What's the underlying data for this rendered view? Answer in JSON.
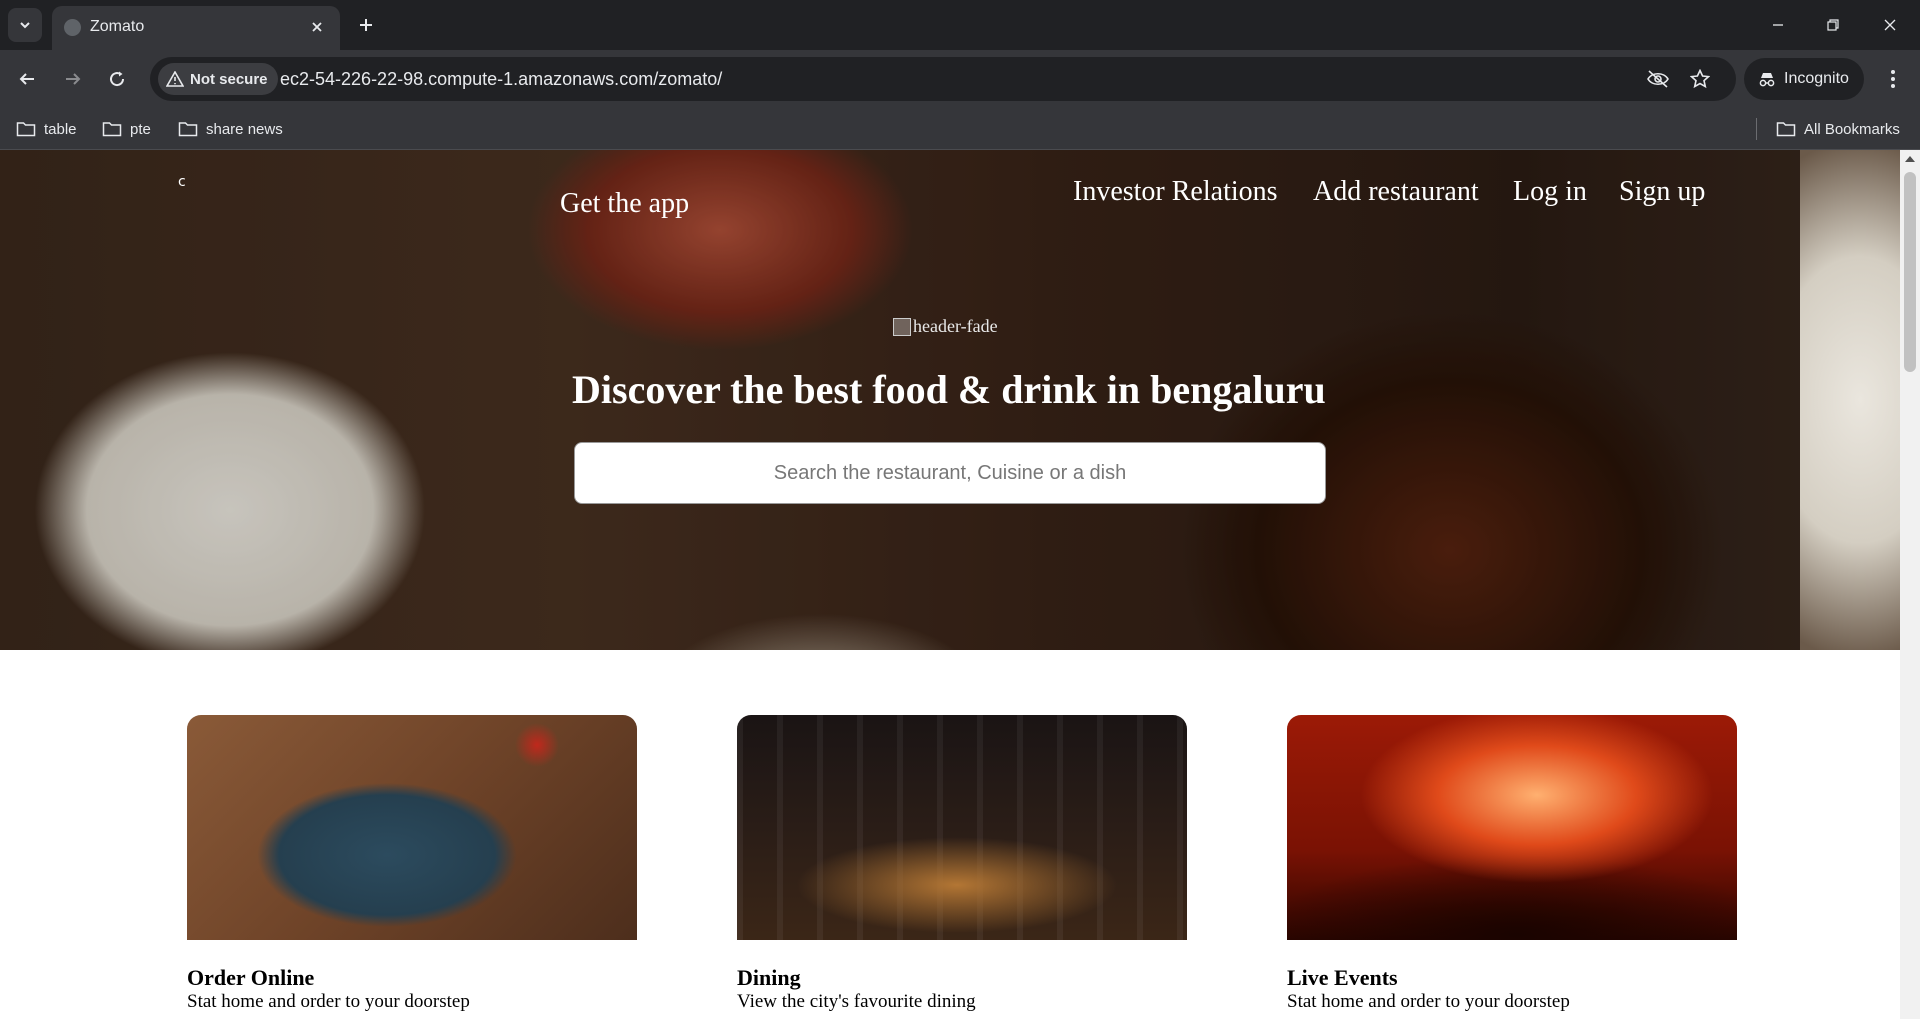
{
  "browser": {
    "tab_title": "Zomato",
    "security_label": "Not secure",
    "url": "ec2-54-226-22-98.compute-1.amazonaws.com/zomato/",
    "profile_label": "Incognito",
    "bookmarks": [
      "table",
      "pte",
      "share news"
    ],
    "all_bookmarks_label": "All Bookmarks"
  },
  "page": {
    "hero_glyph": "c",
    "get_app": "Get the app",
    "nav": {
      "investor": "Investor Relations",
      "add_restaurant": "Add restaurant",
      "login": "Log in",
      "signup": "Sign up"
    },
    "header_fade_alt": "header-fade",
    "title": "Discover the best food & drink in bengaluru",
    "search_placeholder": "Search the restaurant, Cuisine or a dish",
    "cards": [
      {
        "title": "Order Online",
        "desc": "Stat home and order to your doorstep"
      },
      {
        "title": "Dining",
        "desc": "View the city's favourite dining"
      },
      {
        "title": "Live Events",
        "desc": "Stat home and order to your doorstep"
      }
    ]
  }
}
